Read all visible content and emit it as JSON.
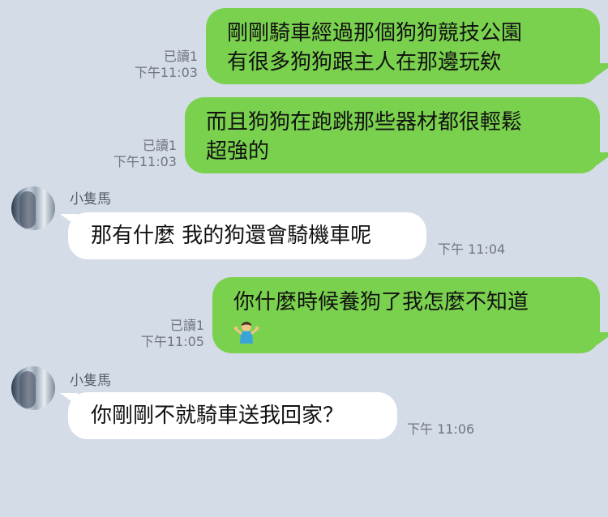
{
  "colors": {
    "background": "#d4dce7",
    "outgoing_bubble": "#7ad14e",
    "incoming_bubble": "#ffffff"
  },
  "messages": [
    {
      "direction": "outgoing",
      "lines": [
        "剛剛騎車經過那個狗狗競技公園",
        "有很多狗狗跟主人在那邊玩欸"
      ],
      "read": "已讀1",
      "time": "下午11:03"
    },
    {
      "direction": "outgoing",
      "lines": [
        "而且狗狗在跑跳那些器材都很輕鬆",
        "超強的"
      ],
      "read": "已讀1",
      "time": "下午11:03"
    },
    {
      "direction": "incoming",
      "sender": "小隻馬",
      "lines": [
        "那有什麼 我的狗還會騎機車呢"
      ],
      "time": "下午 11:04"
    },
    {
      "direction": "outgoing",
      "lines": [
        "你什麼時候養狗了我怎麼不知道"
      ],
      "emoji": "person-shrugging-emoji",
      "read": "已讀1",
      "time": "下午11:05"
    },
    {
      "direction": "incoming",
      "sender": "小隻馬",
      "lines": [
        "你剛剛不就騎車送我回家？"
      ],
      "time": "下午 11:06"
    }
  ]
}
